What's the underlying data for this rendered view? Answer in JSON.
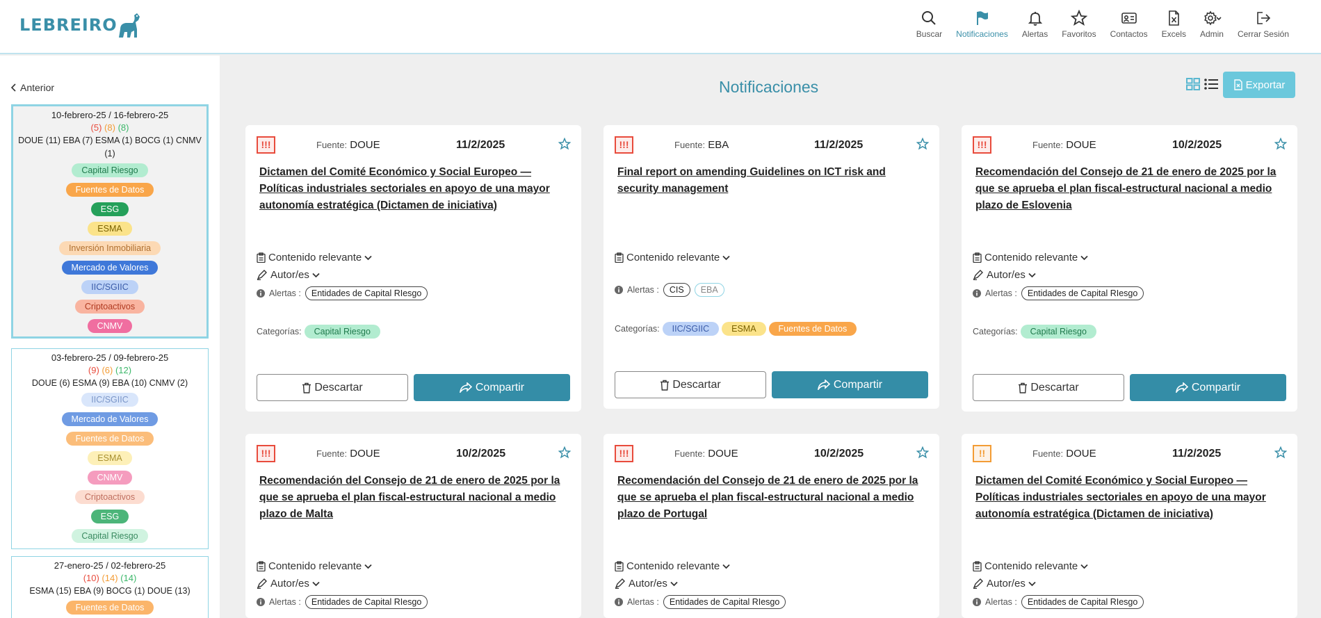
{
  "brand": {
    "logo_text": "LEBREIRO"
  },
  "nav": [
    {
      "label": "Buscar",
      "icon": "search-icon"
    },
    {
      "label": "Notificaciones",
      "icon": "flag-icon",
      "active": true
    },
    {
      "label": "Alertas",
      "icon": "bell-icon"
    },
    {
      "label": "Favoritos",
      "icon": "star-icon"
    },
    {
      "label": "Contactos",
      "icon": "contact-card-icon"
    },
    {
      "label": "Excels",
      "icon": "excel-file-icon"
    },
    {
      "label": "Admin",
      "icon": "gear-icon"
    },
    {
      "label": "Cerrar Sesión",
      "icon": "logout-icon"
    }
  ],
  "sidebar": {
    "back_label": "Anterior",
    "weeks": [
      {
        "range": "10-febrero-25 / 16-febrero-25",
        "counts": {
          "red": "(5)",
          "orange": "(8)",
          "green": "(8)"
        },
        "sources": "DOUE (11) EBA (7) ESMA (1) BOCG (1) CNMV (1)",
        "tags": [
          "Capital Riesgo",
          "Fuentes de Datos",
          "ESG",
          "ESMA",
          "Inversión Inmobiliaria",
          "Mercado de Valores",
          "IIC/SGIIC",
          "Criptoactivos",
          "CNMV"
        ]
      },
      {
        "range": "03-febrero-25 / 09-febrero-25",
        "counts": {
          "red": "(9)",
          "orange": "(6)",
          "green": "(12)"
        },
        "sources": "DOUE (6) ESMA (9) EBA (10) CNMV (2)",
        "tags": [
          "IIC/SGIIC",
          "Mercado de Valores",
          "Fuentes de Datos",
          "ESMA",
          "CNMV",
          "Criptoactivos",
          "ESG",
          "Capital Riesgo"
        ]
      },
      {
        "range": "27-enero-25 / 02-febrero-25",
        "counts": {
          "red": "(10)",
          "orange": "(14)",
          "green": "(14)"
        },
        "sources": "ESMA (15) EBA (9) BOCG (1) DOUE (13)",
        "tags": [
          "Fuentes de Datos"
        ]
      }
    ]
  },
  "main": {
    "title": "Notificaciones",
    "export_label": "Exportar",
    "cards": [
      {
        "priority": "!!!",
        "fuente_label": "Fuente:",
        "fuente": "DOUE",
        "date": "11/2/2025",
        "title": "Dictamen del Comité Económico y Social Europeo — Políticas industriales sectoriales en apoyo de una mayor autonomía estratégica (Dictamen de iniciativa)",
        "contenido": "Contenido relevante",
        "autores": "Autor/es",
        "alertas_label": "Alertas :",
        "alertas": [
          "Entidades de Capital RIesgo"
        ],
        "cats_label": "Categorías:",
        "cats": [
          "Capital Riesgo"
        ],
        "descartar": "Descartar",
        "compartir": "Compartir"
      },
      {
        "priority": "!!!",
        "fuente_label": "Fuente:",
        "fuente": "EBA",
        "date": "11/2/2025",
        "title": "Final report on amending Guidelines on ICT risk and security management",
        "contenido": "Contenido relevante",
        "autores": "",
        "alertas_label": "Alertas :",
        "alertas": [
          "CIS",
          "EBA"
        ],
        "cats_label": "Categorías:",
        "cats": [
          "IIC/SGIIC",
          "ESMA",
          "Fuentes de Datos"
        ],
        "descartar": "Descartar",
        "compartir": "Compartir"
      },
      {
        "priority": "!!!",
        "fuente_label": "Fuente:",
        "fuente": "DOUE",
        "date": "10/2/2025",
        "title": "Recomendación del Consejo de 21 de enero de 2025 por la que se aprueba el plan fiscal-estructural nacional a medio plazo de Eslovenia",
        "contenido": "Contenido relevante",
        "autores": "Autor/es",
        "alertas_label": "Alertas :",
        "alertas": [
          "Entidades de Capital RIesgo"
        ],
        "cats_label": "Categorías:",
        "cats": [
          "Capital Riesgo"
        ],
        "descartar": "Descartar",
        "compartir": "Compartir"
      },
      {
        "priority": "!!!",
        "fuente_label": "Fuente:",
        "fuente": "DOUE",
        "date": "10/2/2025",
        "title": "Recomendación del Consejo de 21 de enero de 2025 por la que se aprueba el plan fiscal-estructural nacional a medio plazo de Malta",
        "contenido": "Contenido relevante",
        "autores": "Autor/es",
        "alertas_label": "Alertas :",
        "alertas": [
          "Entidades de Capital RIesgo"
        ]
      },
      {
        "priority": "!!!",
        "fuente_label": "Fuente:",
        "fuente": "DOUE",
        "date": "10/2/2025",
        "title": "Recomendación del Consejo de 21 de enero de 2025 por la que se aprueba el plan fiscal-estructural nacional a medio plazo de Portugal",
        "contenido": "Contenido relevante",
        "autores": "Autor/es",
        "alertas_label": "Alertas :",
        "alertas": [
          "Entidades de Capital RIesgo"
        ]
      },
      {
        "priority": "!!",
        "fuente_label": "Fuente:",
        "fuente": "DOUE",
        "date": "11/2/2025",
        "title": "Dictamen del Comité Económico y Social Europeo — Políticas industriales sectoriales en apoyo de una mayor autonomía estratégica (Dictamen de iniciativa)",
        "contenido": "Contenido relevante",
        "autores": "Autor/es",
        "alertas_label": "Alertas :",
        "alertas": [
          "Entidades de Capital RIesgo"
        ]
      }
    ]
  },
  "colors": {
    "accent": "#3a8fa8",
    "share_button": "#348da7",
    "export_button": "#6bc8dc",
    "priority_high": "#e84b3c",
    "priority_medium": "#f39c35"
  }
}
